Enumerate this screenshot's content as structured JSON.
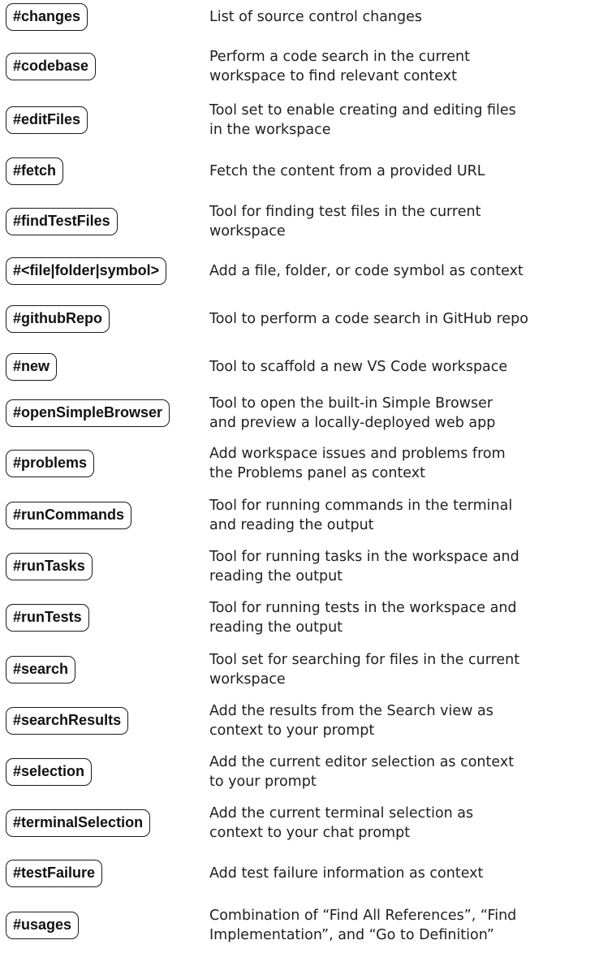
{
  "tools": [
    {
      "tag": "#changes",
      "desc": [
        "List of source control changes"
      ]
    },
    {
      "tag": "#codebase",
      "desc": [
        "Perform a code search in the current",
        "workspace to find relevant context"
      ]
    },
    {
      "tag": "#editFiles",
      "desc": [
        "Tool set to enable creating and editing files",
        "in the workspace"
      ]
    },
    {
      "tag": "#fetch",
      "desc": [
        "Fetch the content from a provided URL"
      ]
    },
    {
      "tag": "#findTestFiles",
      "desc": [
        "Tool for finding test files in the current",
        "workspace"
      ]
    },
    {
      "tag": "#<file|folder|symbol>",
      "desc": [
        "Add a file, folder, or code symbol as context"
      ]
    },
    {
      "tag": "#githubRepo",
      "desc": [
        "Tool to perform a code search in GitHub repo"
      ]
    },
    {
      "tag": "#new",
      "desc": [
        "Tool to scaffold a new VS Code workspace"
      ]
    },
    {
      "tag": "#openSimpleBrowser",
      "desc": [
        "Tool to open the built-in Simple Browser",
        "and preview a locally-deployed web app"
      ]
    },
    {
      "tag": "#problems",
      "desc": [
        "Add workspace issues and problems from",
        "the Problems panel as context"
      ]
    },
    {
      "tag": "#runCommands",
      "desc": [
        "Tool for running commands in the terminal",
        "and reading the output"
      ]
    },
    {
      "tag": "#runTasks",
      "desc": [
        "Tool for running tasks in the workspace and",
        "reading the output"
      ]
    },
    {
      "tag": "#runTests",
      "desc": [
        "Tool for running tests in the workspace and",
        "reading the output"
      ]
    },
    {
      "tag": "#search",
      "desc": [
        "Tool set for searching for files in the current",
        "workspace"
      ]
    },
    {
      "tag": "#searchResults",
      "desc": [
        "Add the results from the Search view as",
        "context to your prompt"
      ]
    },
    {
      "tag": "#selection",
      "desc": [
        "Add the current editor selection as context",
        "to your prompt"
      ]
    },
    {
      "tag": "#terminalSelection",
      "desc": [
        "Add the current terminal selection as",
        "context to your chat prompt"
      ]
    },
    {
      "tag": "#testFailure",
      "desc": [
        "Add test failure information as context"
      ]
    },
    {
      "tag": "#usages",
      "desc": [
        "Combination of “Find All References”, “Find",
        "Implementation”, and “Go to Definition”"
      ]
    }
  ]
}
